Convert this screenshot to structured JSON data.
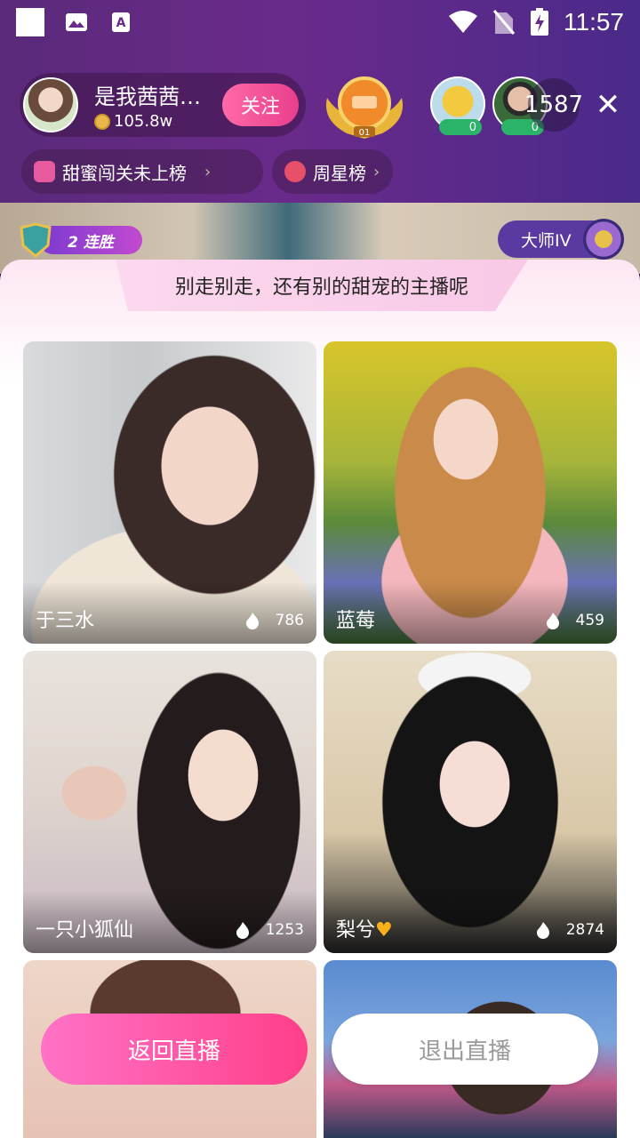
{
  "status_bar": {
    "time": "11:57",
    "left_icons": [
      "square-icon",
      "image-icon",
      "font-icon"
    ],
    "right_icons": [
      "wifi-icon",
      "no-sim-icon",
      "battery-charging-icon"
    ]
  },
  "host": {
    "name": "是我茜茜…",
    "coins": "105.8w",
    "follow_label": "关注"
  },
  "rank_badge": {
    "label": "01"
  },
  "viewers": [
    {
      "count": "0"
    },
    {
      "count": "0"
    }
  ],
  "viewer_total": "1587",
  "tags": [
    {
      "label": "甜蜜闯关未上榜",
      "icon": "heart-icon"
    },
    {
      "label": "周星榜",
      "icon": "star-icon"
    }
  ],
  "battle": {
    "streak_label": "2 连胜",
    "master_label": "大师IV"
  },
  "sheet": {
    "title": "别走别走，还有别的甜宠的主播呢"
  },
  "cards": [
    {
      "name": "于三水",
      "heat": "786"
    },
    {
      "name": "蓝莓",
      "heat": "459"
    },
    {
      "name": "一只小狐仙",
      "heat": "1253"
    },
    {
      "name": "梨兮",
      "heat": "2874"
    },
    {
      "name": "",
      "heat": ""
    },
    {
      "name": "",
      "heat": ""
    }
  ],
  "buttons": {
    "back_label": "返回直播",
    "exit_label": "退出直播"
  },
  "colors": {
    "accent": "#ff3f8a",
    "header_bg": "#5a2a7a",
    "viewer_badge": "#2cb36a"
  }
}
